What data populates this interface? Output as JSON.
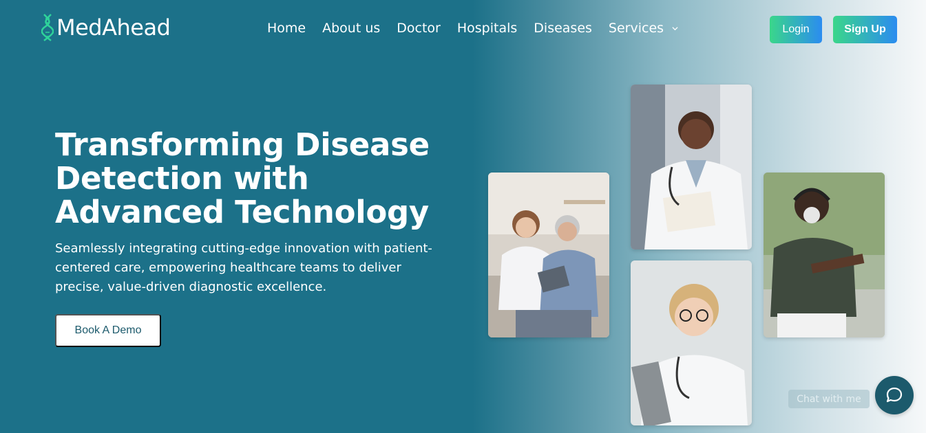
{
  "brand": {
    "name": "MedAhead",
    "icon": "dna-icon"
  },
  "nav": {
    "items": [
      {
        "label": "Home"
      },
      {
        "label": "About us"
      },
      {
        "label": "Doctor"
      },
      {
        "label": "Hospitals"
      },
      {
        "label": "Diseases"
      },
      {
        "label": "Services",
        "icon": "chevron-down-icon"
      }
    ]
  },
  "auth": {
    "login_label": "Login",
    "signup_label": "Sign Up"
  },
  "hero": {
    "title": "Transforming Disease Detection with Advanced Technology",
    "subtitle": "Seamlessly integrating cutting-edge innovation with patient-centered care, empowering healthcare teams to deliver precise, value-driven diagnostic excellence.",
    "cta_label": "Book A Demo"
  },
  "chat": {
    "label": "Chat with me",
    "icon": "chat-bubble-icon"
  },
  "colors": {
    "hero_bg": "#1c7189",
    "accent_start": "#3ad68a",
    "accent_end": "#2b8cf0",
    "chat_bg": "#1c5a6c"
  }
}
